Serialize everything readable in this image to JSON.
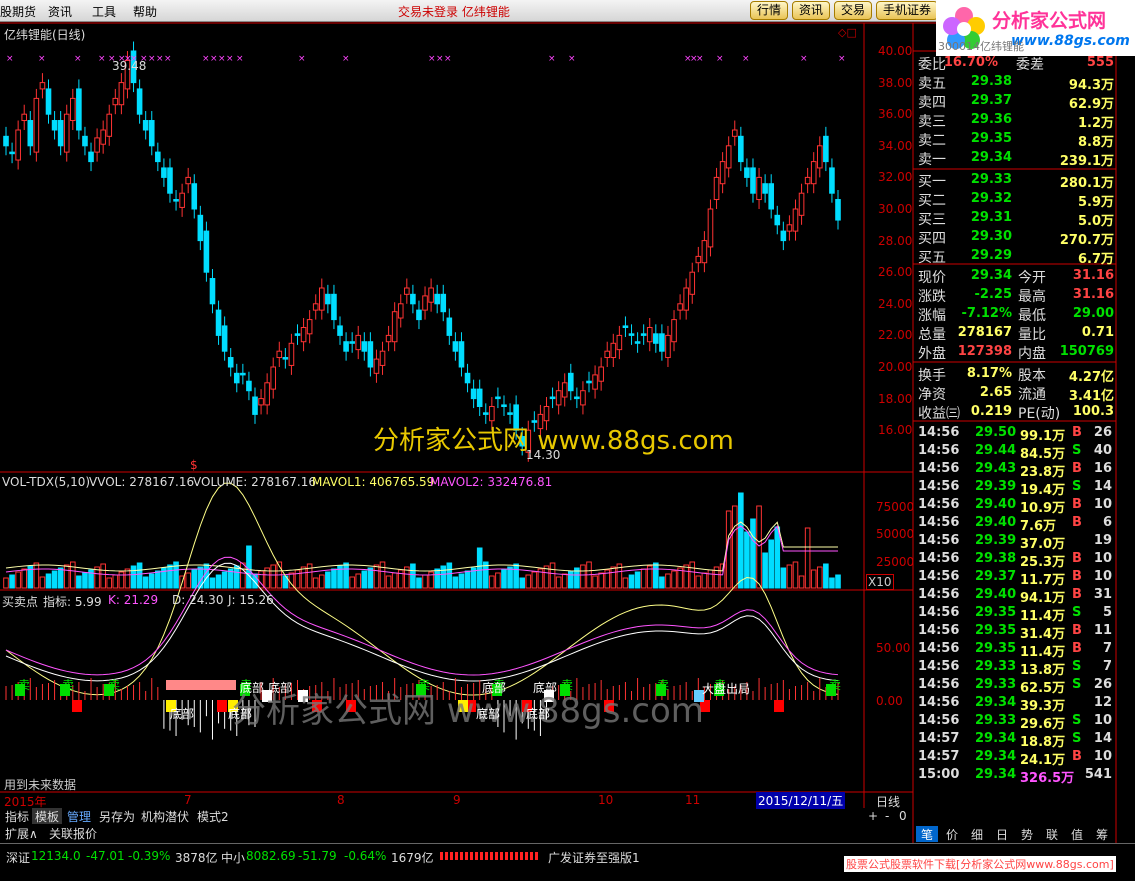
{
  "menu": {
    "items": [
      "股期货",
      "资讯",
      "工具",
      "帮助"
    ],
    "title_left": "交易未登录",
    "title_right": "亿纬锂能",
    "buttons": [
      "行情",
      "资讯",
      "交易",
      "手机证券"
    ]
  },
  "logo": {
    "brand": "分析家公式网",
    "url": "www.88gs.com"
  },
  "chart": {
    "title": "亿纬锂能(日线)",
    "watermark": "分析家公式网 www.88gs.com",
    "watermark2": "分析家公式网 www.88gs.com",
    "max_label": "39.48",
    "min_label": "14.30",
    "s_marker": "$",
    "right_code": "300014亿纬锂能",
    "under_text": "用到未来数据",
    "price_ticks": [
      "40.00",
      "38.00",
      "36.00",
      "34.00",
      "32.00",
      "30.00",
      "28.00",
      "26.00",
      "24.00",
      "22.00",
      "20.00",
      "18.00",
      "16.00"
    ],
    "vol_header": {
      "name": "VOL-TDX(5,10)",
      "vvol": "VVOL: 278167.16",
      "volume": "VOLUME: 278167.16",
      "mavol1": "MAVOL1: 406765.59",
      "mavol2": "MAVOL2: 332476.81"
    },
    "vol_ticks": [
      "75000",
      "50000",
      "25000"
    ],
    "vol_unit": "X10",
    "ind_header": {
      "name": "买卖点",
      "zb": "指标: 5.99",
      "k": "K: 21.29",
      "d": "D: 24.30",
      "j": "J: 15.26"
    },
    "ind_ticks": [
      "50.00",
      "0.00"
    ],
    "signals": {
      "sell": "卖",
      "buy": "买",
      "bottom": "底部",
      "big": "大盘出局"
    },
    "date_axis": {
      "year": "2015年",
      "months": [
        "7",
        "8",
        "9",
        "10",
        "11"
      ],
      "current": "2015/12/11/五",
      "period": "日线"
    }
  },
  "quote": {
    "ratio": {
      "label": "委比",
      "value": "16.70%",
      "label2": "委差",
      "value2": "555"
    },
    "sell": [
      {
        "label": "卖五",
        "price": "29.38",
        "vol": "94.3万"
      },
      {
        "label": "卖四",
        "price": "29.37",
        "vol": "62.9万"
      },
      {
        "label": "卖三",
        "price": "29.36",
        "vol": "1.2万"
      },
      {
        "label": "卖二",
        "price": "29.35",
        "vol": "8.8万"
      },
      {
        "label": "卖一",
        "price": "29.34",
        "vol": "239.1万"
      }
    ],
    "buy": [
      {
        "label": "买一",
        "price": "29.33",
        "vol": "280.1万"
      },
      {
        "label": "买二",
        "price": "29.32",
        "vol": "5.9万"
      },
      {
        "label": "买三",
        "price": "29.31",
        "vol": "5.0万"
      },
      {
        "label": "买四",
        "price": "29.30",
        "vol": "270.7万"
      },
      {
        "label": "买五",
        "price": "29.29",
        "vol": "6.7万"
      }
    ],
    "stats": [
      {
        "l1": "现价",
        "v1": "29.34",
        "l2": "今开",
        "v2": "31.16",
        "c1": "#00e000",
        "c2": "#ff4444"
      },
      {
        "l1": "涨跌",
        "v1": "-2.25",
        "l2": "最高",
        "v2": "31.16",
        "c1": "#00e000",
        "c2": "#ff4444"
      },
      {
        "l1": "涨幅",
        "v1": "-7.12%",
        "l2": "最低",
        "v2": "29.00",
        "c1": "#00e000",
        "c2": "#00e000"
      },
      {
        "l1": "总量",
        "v1": "278167",
        "l2": "量比",
        "v2": "0.71",
        "c1": "#ffff66",
        "c2": "#ffff66"
      },
      {
        "l1": "外盘",
        "v1": "127398",
        "l2": "内盘",
        "v2": "150769",
        "c1": "#ff4444",
        "c2": "#00e000"
      },
      {
        "l1": "换手",
        "v1": "8.17%",
        "l2": "股本",
        "v2": "4.27亿",
        "c1": "#ffff66",
        "c2": "#ffff66"
      },
      {
        "l1": "净资",
        "v1": "2.65",
        "l2": "流通",
        "v2": "3.41亿",
        "c1": "#ffff66",
        "c2": "#ffff66"
      },
      {
        "l1": "收益㈢",
        "v1": "0.219",
        "l2": "PE(动)",
        "v2": "100.3",
        "c1": "#ffff66",
        "c2": "#ffff66"
      }
    ],
    "ticks": [
      {
        "t": "14:56",
        "p": "29.50",
        "v": "99.1万",
        "bs": "B",
        "n": "26"
      },
      {
        "t": "14:56",
        "p": "29.44",
        "v": "84.5万",
        "bs": "S",
        "n": "40"
      },
      {
        "t": "14:56",
        "p": "29.43",
        "v": "23.8万",
        "bs": "B",
        "n": "16"
      },
      {
        "t": "14:56",
        "p": "29.39",
        "v": "19.4万",
        "bs": "S",
        "n": "14"
      },
      {
        "t": "14:56",
        "p": "29.40",
        "v": "10.9万",
        "bs": "B",
        "n": "10"
      },
      {
        "t": "14:56",
        "p": "29.40",
        "v": "7.6万",
        "bs": "B",
        "n": "6"
      },
      {
        "t": "14:56",
        "p": "29.39",
        "v": "37.0万",
        "bs": "",
        "n": "19"
      },
      {
        "t": "14:56",
        "p": "29.38",
        "v": "25.3万",
        "bs": "B",
        "n": "10"
      },
      {
        "t": "14:56",
        "p": "29.37",
        "v": "11.7万",
        "bs": "B",
        "n": "10"
      },
      {
        "t": "14:56",
        "p": "29.40",
        "v": "94.1万",
        "bs": "B",
        "n": "31"
      },
      {
        "t": "14:56",
        "p": "29.35",
        "v": "11.4万",
        "bs": "S",
        "n": "5"
      },
      {
        "t": "14:56",
        "p": "29.35",
        "v": "31.4万",
        "bs": "B",
        "n": "11"
      },
      {
        "t": "14:56",
        "p": "29.35",
        "v": "11.4万",
        "bs": "B",
        "n": "7"
      },
      {
        "t": "14:56",
        "p": "29.33",
        "v": "13.8万",
        "bs": "S",
        "n": "7"
      },
      {
        "t": "14:56",
        "p": "29.33",
        "v": "62.5万",
        "bs": "S",
        "n": "26"
      },
      {
        "t": "14:56",
        "p": "29.34",
        "v": "39.3万",
        "bs": "",
        "n": "12"
      },
      {
        "t": "14:56",
        "p": "29.33",
        "v": "29.6万",
        "bs": "S",
        "n": "10"
      },
      {
        "t": "14:57",
        "p": "29.34",
        "v": "18.8万",
        "bs": "S",
        "n": "14"
      },
      {
        "t": "14:57",
        "p": "29.34",
        "v": "24.1万",
        "bs": "B",
        "n": "10"
      },
      {
        "t": "15:00",
        "p": "29.34",
        "v": "326.5万",
        "bs": "",
        "n": "541"
      }
    ]
  },
  "bottom_tabs": [
    "指标",
    "模板",
    "管理",
    "另存为",
    "机构潜伏",
    "模式2"
  ],
  "bottom_tabs2": [
    "扩展∧",
    "关联报价"
  ],
  "right_tabs": [
    "笔",
    "价",
    "细",
    "日",
    "势",
    "联",
    "值",
    "筹"
  ],
  "nav": {
    "plus": "+",
    "minus": "-",
    "zero": "0"
  },
  "status": {
    "sz_label": "深证",
    "sz_val": "12134.0",
    "sz_chg": "-47.01",
    "sz_pct": "-0.39%",
    "sz_amt": "3878亿",
    "zx_label": "中小",
    "zx_val": "8082.69",
    "zx_chg": "-51.79",
    "zx_pct": "-0.64%",
    "zx_amt": "1679亿",
    "broker": "广发证券至强版1",
    "ad": "股票公式股票软件下载[分析家公式网www.88gs.com]"
  }
}
